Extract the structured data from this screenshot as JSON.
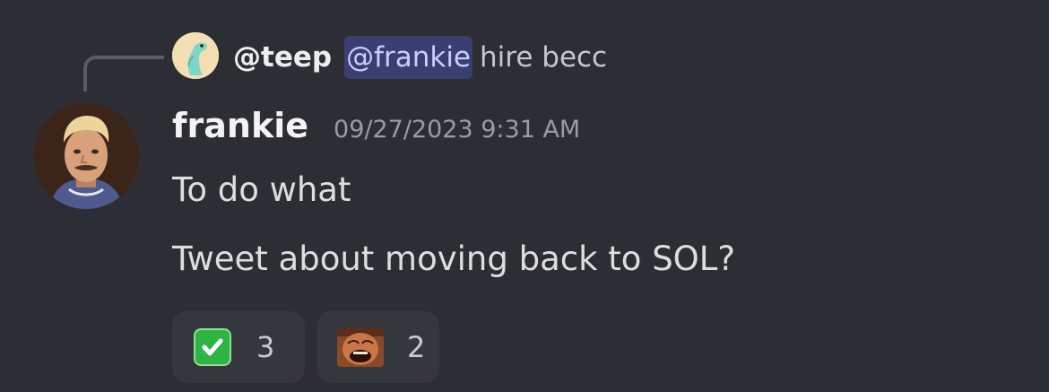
{
  "reply": {
    "author": "@teep",
    "mention": "@frankie",
    "text": "hire becc"
  },
  "message": {
    "author": "frankie",
    "timestamp": "09/27/2023 9:31 AM",
    "lines": [
      "To do what",
      "Tweet about moving back to SOL?"
    ]
  },
  "reactions": [
    {
      "emoji": "white-check-mark",
      "count": "3"
    },
    {
      "emoji": "laughing-man-custom",
      "count": "2"
    }
  ],
  "colors": {
    "background": "#2d2e33",
    "mention_bg": "#3e4272",
    "reaction_bg": "#36373d",
    "check_green": "#2fb344"
  }
}
